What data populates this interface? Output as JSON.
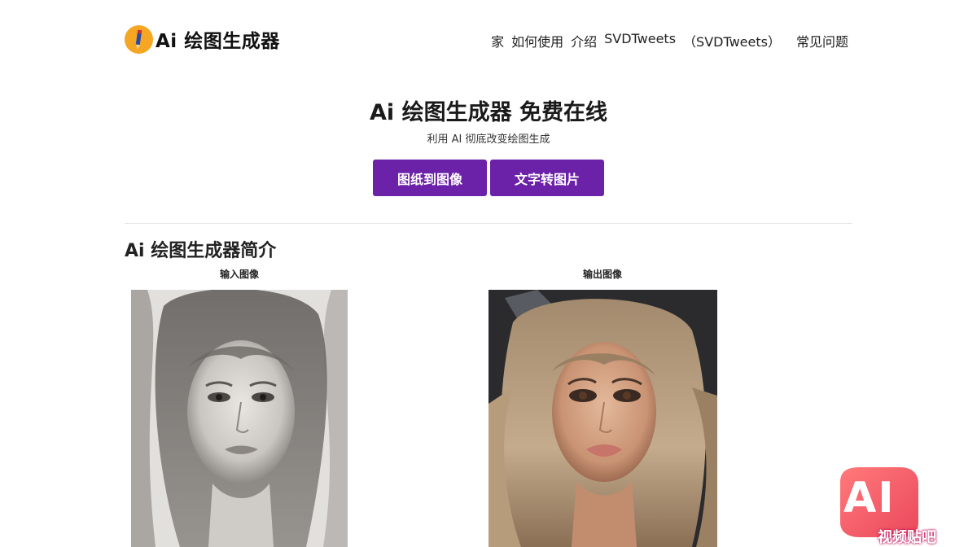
{
  "header": {
    "brand_name": "Ai 绘图生成器",
    "nav": [
      {
        "label": "家"
      },
      {
        "label": "如何使用"
      },
      {
        "label": "介绍"
      },
      {
        "label": "SVDTweets"
      },
      {
        "label": "（SVDTweets）"
      },
      {
        "label": "常见问题"
      }
    ]
  },
  "hero": {
    "title": "Ai 绘图生成器 免费在线",
    "subtitle": "利用 AI 彻底改变绘图生成",
    "buttons": [
      {
        "label": "图纸到图像"
      },
      {
        "label": "文字转图片"
      }
    ],
    "button_color": "#6b21a8"
  },
  "intro": {
    "title": "Ai 绘图生成器简介",
    "input_label": "输入图像",
    "output_label": "输出图像"
  },
  "watermark": {
    "text_big": "AI",
    "text_small": "视频贴吧"
  }
}
